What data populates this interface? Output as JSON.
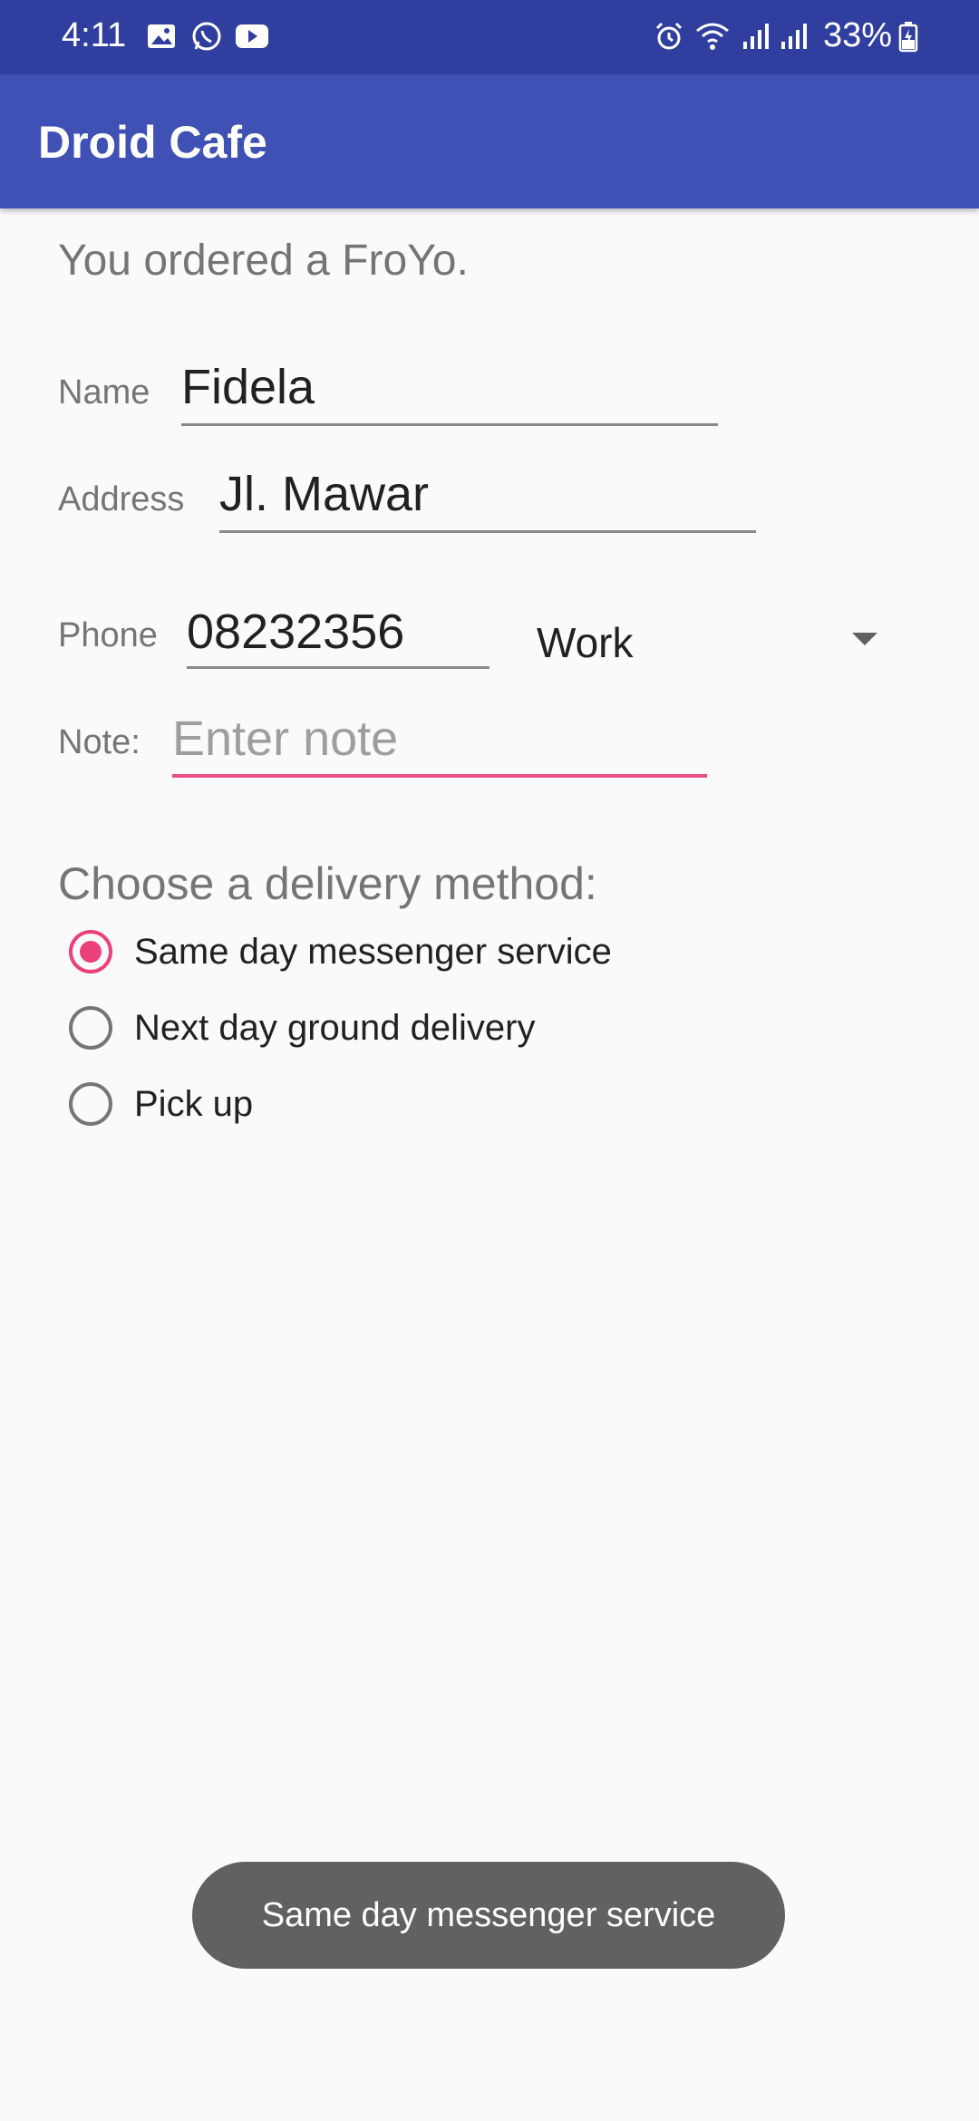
{
  "status_bar": {
    "time": "4:11",
    "battery": "33%",
    "icons": [
      "image-icon",
      "whatsapp-icon",
      "youtube-icon",
      "alarm-icon",
      "wifi-icon",
      "signal-icon",
      "signal-icon",
      "battery-icon"
    ]
  },
  "app": {
    "title": "Droid Cafe"
  },
  "order": {
    "message": "You ordered a FroYo."
  },
  "form": {
    "name_label": "Name",
    "name_value": "Fidela",
    "address_label": "Address",
    "address_value": "Jl. Mawar",
    "phone_label": "Phone",
    "phone_value": "08232356",
    "phone_type": "Work",
    "note_label": "Note:",
    "note_placeholder": "Enter note"
  },
  "delivery": {
    "title": "Choose a delivery method:",
    "options": [
      {
        "label": "Same day messenger service",
        "checked": true
      },
      {
        "label": "Next day ground delivery",
        "checked": false
      },
      {
        "label": "Pick up",
        "checked": false
      }
    ]
  },
  "toast": {
    "text": "Same day messenger service"
  },
  "colors": {
    "primary": "#3f51b5",
    "primary_dark": "#303f9f",
    "accent": "#ec407a"
  }
}
